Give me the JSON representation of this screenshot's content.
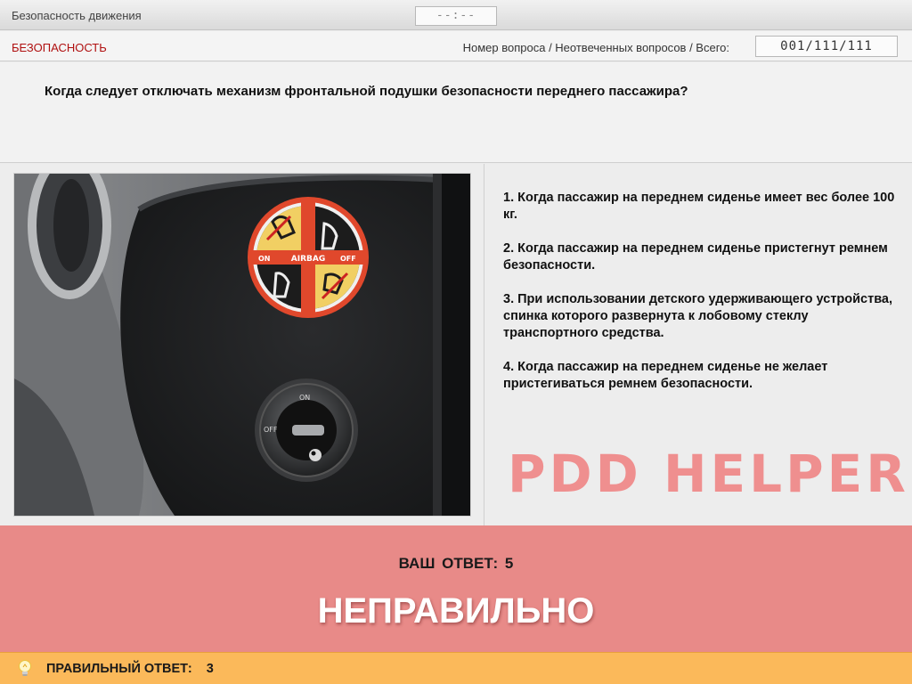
{
  "app": {
    "title": "Безопасность движения",
    "timer": "--:--"
  },
  "infobar": {
    "category": "БЕЗОПАСНОСТЬ",
    "counter_label": "Номер вопроса / Неотвеченных вопросов / Всего:",
    "counter_value": "001/111/111"
  },
  "question": {
    "text": "Когда следует отключать механизм фронтальной подушки безопасности переднего пассажира?"
  },
  "photo": {
    "icon": "airbag-label-photo",
    "label_airbag": "AIRBAG",
    "label_on": "ON",
    "label_off": "OFF",
    "switch_on": "ON",
    "switch_off": "OFF"
  },
  "answers": [
    {
      "text": "1.  Когда пассажир на переднем сиденье имеет вес более 100 кг."
    },
    {
      "text": "2.  Когда пассажир на переднем сиденье пристегнут ремнем безопасности."
    },
    {
      "text": "3.  При использовании детского удерживающего устройства, спинка которого развернута к лобовому стеклу транспортного средства."
    },
    {
      "text": "4.  Когда пассажир на переднем сиденье не желает пристегиваться ремнем безопасности."
    }
  ],
  "watermark": "PDD HELPER",
  "result": {
    "your_answer_label": "ВАШ  ОТВЕТ:",
    "your_answer_value": "5",
    "verdict": "НЕПРАВИЛЬНО",
    "color": "#e88a88"
  },
  "correct": {
    "label": "ПРАВИЛЬНЫЙ ОТВЕТ:",
    "value": "3",
    "icon": "lightbulb-icon",
    "color": "#fbb95a"
  }
}
